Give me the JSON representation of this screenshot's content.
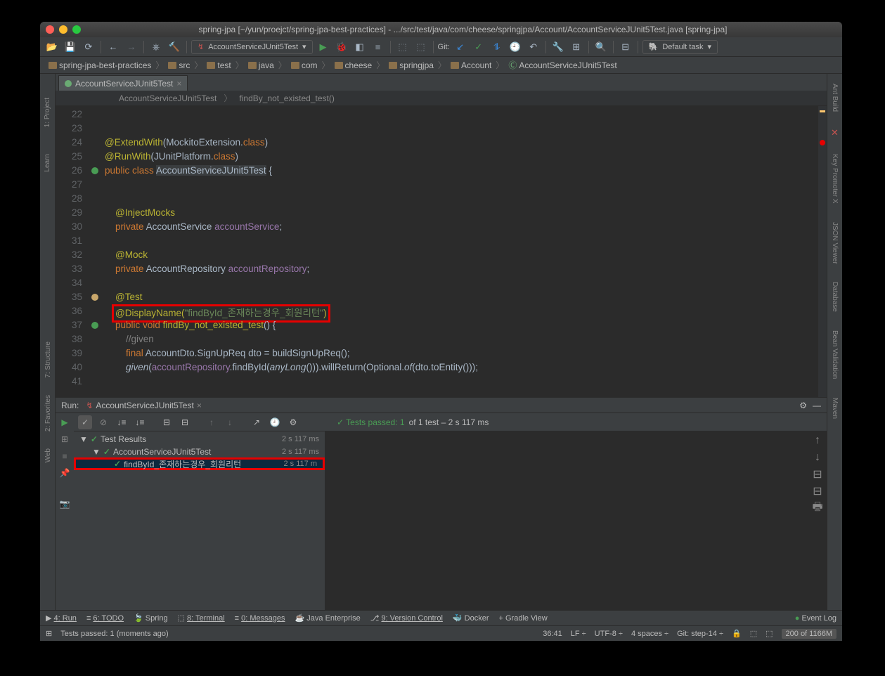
{
  "title": "spring-jpa [~/yun/proejct/spring-jpa-best-practices] - .../src/test/java/com/cheese/springjpa/Account/AccountServiceJUnit5Test.java [spring-jpa]",
  "runConfig": "AccountServiceJUnit5Test",
  "defaultTask": "Default task",
  "gitLabel": "Git:",
  "breadcrumbs": [
    "spring-jpa-best-practices",
    "src",
    "test",
    "java",
    "com",
    "cheese",
    "springjpa",
    "Account",
    "AccountServiceJUnit5Test"
  ],
  "editorTab": "AccountServiceJUnit5Test",
  "nav": {
    "cls": "AccountServiceJUnit5Test",
    "method": "findBy_not_existed_test()"
  },
  "lines": {
    "start": 22,
    "end": 41
  },
  "code": {
    "extendWith": "@ExtendWith",
    "mockitoExt": "MockitoExtension",
    "runWith": "@RunWith",
    "junitPlatform": "JUnitPlatform",
    "klass": "class",
    "klassName": "AccountServiceJUnit5Test",
    "injectMocks": "@InjectMocks",
    "private": "private",
    "accountService": "AccountService",
    "accountServiceFld": "accountService",
    "mock": "@Mock",
    "accountRepository": "AccountRepository",
    "accountRepositoryFld": "accountRepository",
    "test": "@Test",
    "displayName": "@DisplayName",
    "displayNameStr": "\"findById_존재하는경우_회원리턴\"",
    "public": "public",
    "void": "void",
    "methodName": "findBy_not_existed_test",
    "cmtGiven": "//given",
    "final": "final",
    "dtoLine": " AccountDto.SignUpReq dto = buildSignUpReq();",
    "given": "given",
    "givenRest1": "accountRepository",
    "givenRest2": ".findById(",
    "anyLong": "anyLong",
    "givenRest3": "())).willReturn(Optional.",
    "of": "of",
    "givenRest4": "(dto.toEntity()));"
  },
  "run": {
    "label": "Run:",
    "tab": "AccountServiceJUnit5Test",
    "passText": "Tests passed: 1",
    "passRest": " of 1 test – 2 s 117 ms",
    "tree": {
      "root": "Test Results",
      "rootDur": "2 s 117 ms",
      "cls": "AccountServiceJUnit5Test",
      "clsDur": "2 s 117 ms",
      "test": "findById_존재하는경우_회원리턴",
      "testDur": "2 s 117 m"
    }
  },
  "bottomTools": [
    "4: Run",
    "6: TODO",
    "Spring",
    "8: Terminal",
    "0: Messages",
    "Java Enterprise",
    "9: Version Control",
    "Docker",
    "Gradle View"
  ],
  "eventLog": "Event Log",
  "status": {
    "msg": "Tests passed: 1 (moments ago)",
    "pos": "36:41",
    "le": "LF",
    "enc": "UTF-8",
    "indent": "4 spaces",
    "git": "Git: step-14",
    "mem": "200 of 1166M"
  },
  "rightRail": [
    "Ant Build",
    "Key Promoter X",
    "JSON Viewer",
    "Database",
    "Bean Validation",
    "Maven"
  ],
  "leftRail": [
    "1: Project",
    "Learn",
    "7: Structure",
    "2: Favorites",
    "Web"
  ]
}
